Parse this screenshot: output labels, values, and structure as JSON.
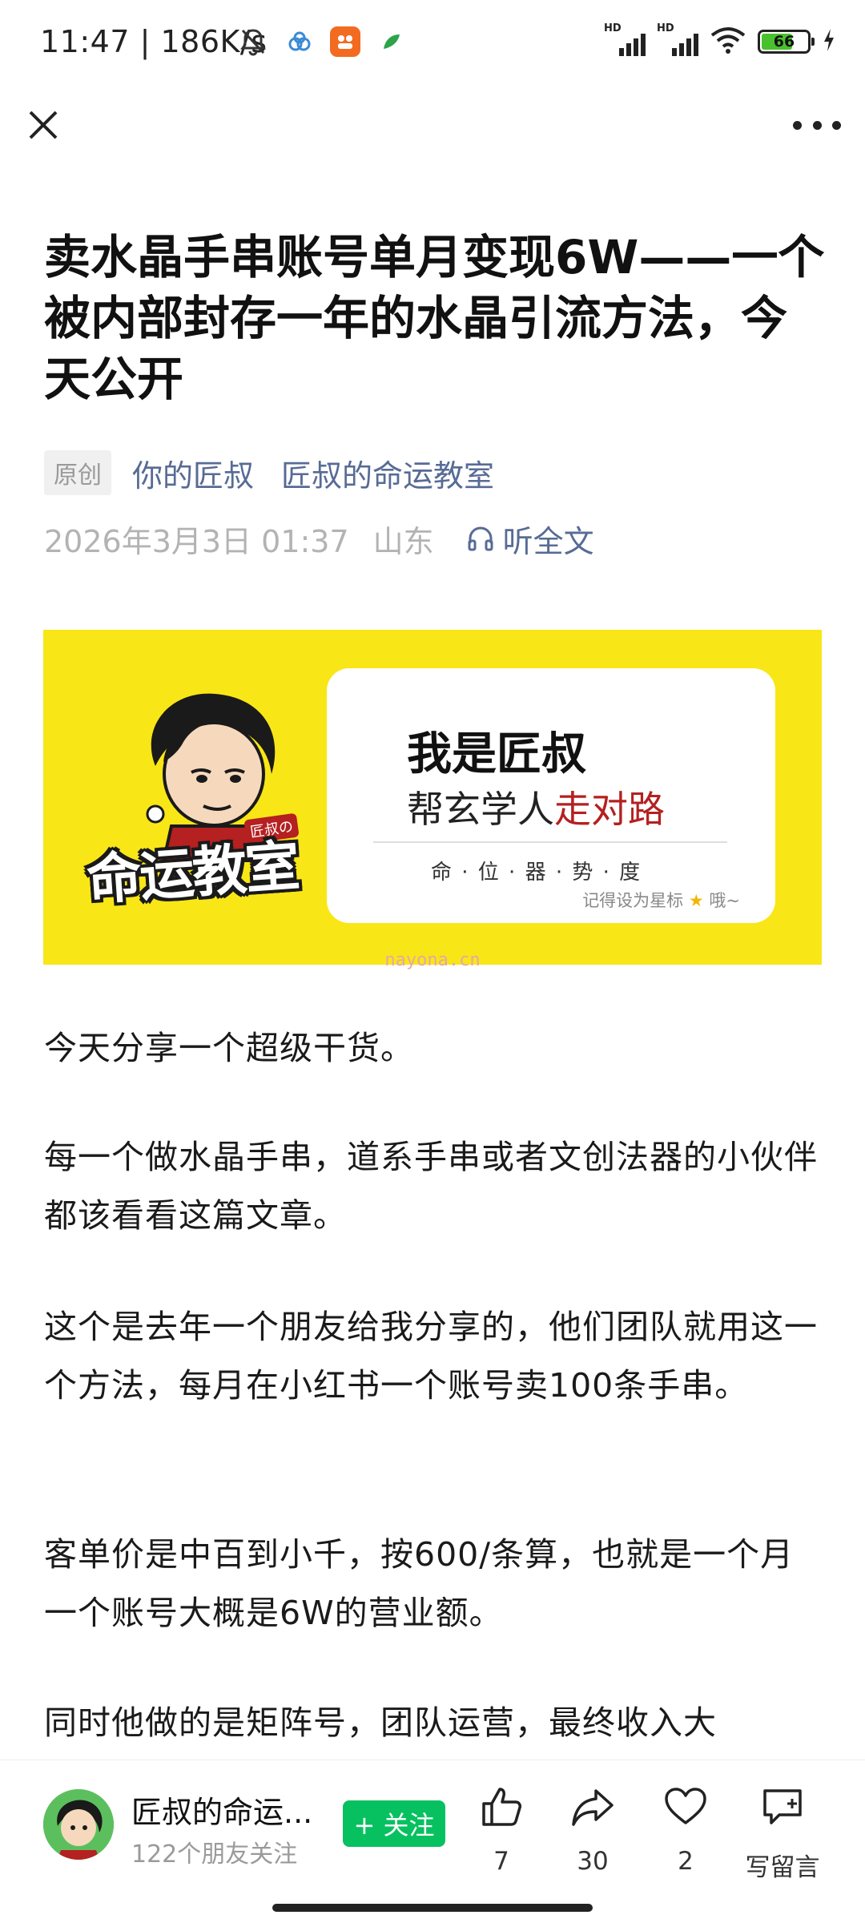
{
  "status_bar": {
    "time": "11:47 | 186K/s",
    "battery": "66",
    "icons": [
      "bell-off-icon",
      "cloud-app-icon",
      "app-badge-icon",
      "leaf-app-icon",
      "hd-signal-icon",
      "hd-signal-icon",
      "wifi-icon",
      "battery-icon",
      "charging-icon"
    ]
  },
  "nav": {
    "close_icon": "close-icon",
    "more_icon": "more-icon"
  },
  "article": {
    "title": "卖水晶手串账号单月变现6W——一个被内部封存一年的水晶引流方法，今天公开",
    "original_tag": "原创",
    "author": "你的匠叔",
    "account": "匠叔的命运教室",
    "date": "2026年3月3日 01:37",
    "location": "山东",
    "listen_label": "听全文"
  },
  "banner": {
    "logo_text": "命运教室",
    "logo_small": "匠叔の",
    "line1": "我是匠叔",
    "line2_prefix": "帮玄学人",
    "line2_highlight": "走对路",
    "line3": "命 · 位 · 器 · 势 · 度",
    "line4_prefix": "记得设为星标",
    "line4_suffix": "哦~"
  },
  "watermark": "nayona.cn",
  "paragraphs": [
    "今天分享一个超级干货。",
    "每一个做水晶手串，道系手串或者文创法器的小伙伴都该看看这篇文章。",
    "这个是去年一个朋友给我分享的，他们团队就用这一个方法，每月在小红书一个账号卖100条手串。",
    "客单价是中百到小千，按600/条算，也就是一个月一个账号大概是6W的营业额。",
    "同时他做的是矩阵号，团队运营，最终收入大"
  ],
  "bottom_bar": {
    "account_name": "匠叔的命运...",
    "followers": "122个朋友关注",
    "follow_label": "+ 关注",
    "likes": "7",
    "shares": "30",
    "favorites": "2",
    "comment_label": "写留言"
  },
  "colors": {
    "link": "#576b95",
    "follow": "#07c160",
    "banner": "#f9e616",
    "highlight": "#b52020"
  }
}
